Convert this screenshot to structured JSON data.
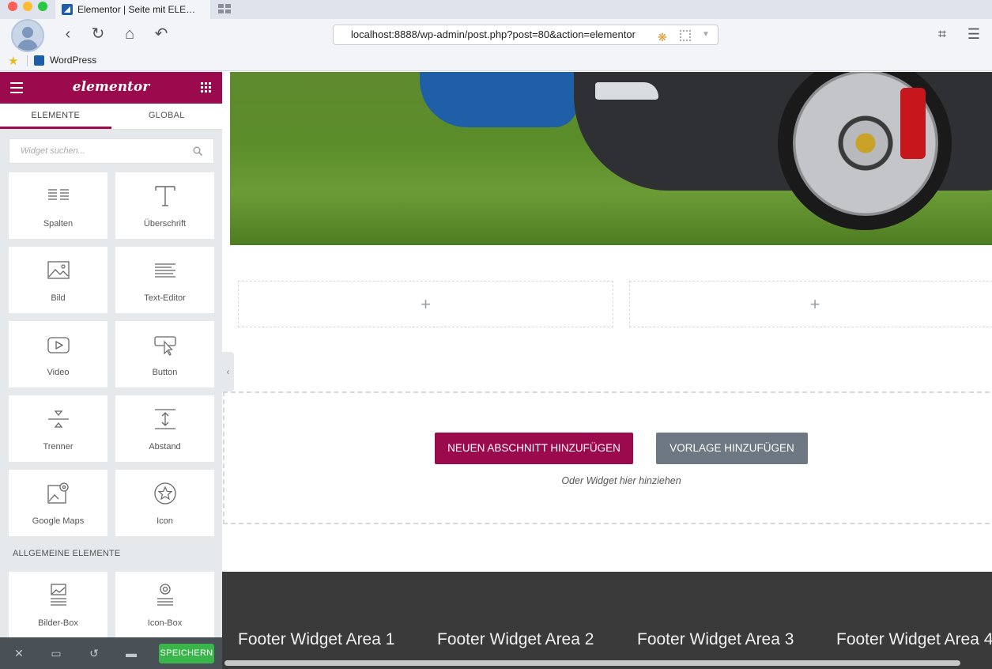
{
  "browser": {
    "tab_title": "Elementor | Seite mit ELE…",
    "url": "localhost:8888/wp-admin/post.php?post=80&action=elementor",
    "bookmark_label": "WordPress"
  },
  "panel": {
    "logo": "elementor",
    "tabs": [
      {
        "label": "ELEMENTE",
        "active": true
      },
      {
        "label": "GLOBAL",
        "active": false
      }
    ],
    "search_placeholder": "Widget suchen...",
    "widgets": [
      {
        "label": "Spalten",
        "icon": "columns-icon"
      },
      {
        "label": "Überschrift",
        "icon": "heading-icon"
      },
      {
        "label": "Bild",
        "icon": "image-icon"
      },
      {
        "label": "Text-Editor",
        "icon": "text-editor-icon"
      },
      {
        "label": "Video",
        "icon": "video-icon"
      },
      {
        "label": "Button",
        "icon": "button-icon"
      },
      {
        "label": "Trenner",
        "icon": "divider-icon"
      },
      {
        "label": "Abstand",
        "icon": "spacer-icon"
      },
      {
        "label": "Google Maps",
        "icon": "google-maps-icon"
      },
      {
        "label": "Icon",
        "icon": "star-icon"
      }
    ],
    "section_label": "ALLGEMEINE ELEMENTE",
    "general_widgets": [
      {
        "label": "Bilder-Box",
        "icon": "image-box-icon"
      },
      {
        "label": "Icon-Box",
        "icon": "icon-box-icon"
      }
    ],
    "save_label": "SPEICHERN"
  },
  "canvas": {
    "add_section_label": "NEUEN ABSCHNITT HINZUFÜGEN",
    "add_template_label": "VORLAGE HINZUFÜGEN",
    "drag_hint": "Oder Widget hier hinziehen",
    "plus_symbol": "+"
  },
  "footer": {
    "areas": [
      "Footer Widget Area 1",
      "Footer Widget Area 2",
      "Footer Widget Area 3",
      "Footer Widget Area 4"
    ]
  },
  "colors": {
    "brand": "#9b0a4c",
    "save": "#39b54a",
    "template_button": "#6d7882",
    "footer_bg": "#3a3a3a"
  }
}
